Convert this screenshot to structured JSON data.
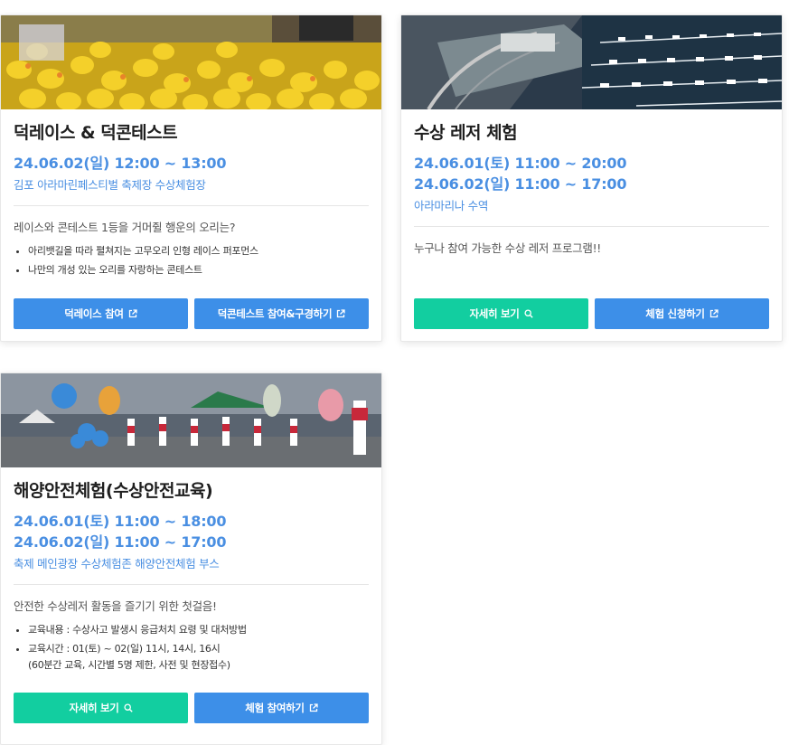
{
  "cards": [
    {
      "title": "덕레이스 & 덕콘테스트",
      "dates": [
        "24.06.02(일) 12:00 ~ 13:00"
      ],
      "location": "김포 아라마린페스티벌 축제장 수상체험장",
      "description": "레이스와 콘테스트 1등을 거머쥘 행운의 오리는?",
      "bullets": [
        "아리뱃길을 따라 펼쳐지는 고무오리 인형 레이스 퍼포먼스",
        "나만의 개성 있는 오리를 자랑하는 콘테스트"
      ],
      "buttons": [
        {
          "label": "덕레이스 참여",
          "icon": "external-link-icon",
          "color": "#3d8fe8"
        },
        {
          "label": "덕콘테스트 참여&구경하기",
          "icon": "external-link-icon",
          "color": "#3d8fe8"
        }
      ]
    },
    {
      "title": "수상 레저 체험",
      "dates": [
        "24.06.01(토) 11:00 ~ 20:00",
        "24.06.02(일) 11:00 ~ 17:00"
      ],
      "location": "아라마리나 수역",
      "description": "누구나 참여 가능한 수상 레저 프로그램!!",
      "buttons": [
        {
          "label": "자세히 보기",
          "icon": "search-icon",
          "color": "#12cea0"
        },
        {
          "label": "체험 신청하기",
          "icon": "external-link-icon",
          "color": "#3d8fe8"
        }
      ]
    },
    {
      "title": "해양안전체험(수상안전교육)",
      "dates": [
        "24.06.01(토) 11:00 ~ 18:00",
        "24.06.02(일) 11:00 ~ 17:00"
      ],
      "location": "축제 메인광장 수상체험존 해양안전체험 부스",
      "description": "안전한 수상레저 활동을 즐기기 위한 첫걸음!",
      "bullets": [
        "교육내용 : 수상사고 발생시 응급처치 요령 및 대처방법",
        "교육시간 : 01(토) ~ 02(일) 11시, 14시, 16시"
      ],
      "bullet_sub": "(60분간 교육, 시간별 5명 제한, 사전 및 현장접수)",
      "buttons": [
        {
          "label": "자세히 보기",
          "icon": "search-icon",
          "color": "#12cea0"
        },
        {
          "label": "체험 참여하기",
          "icon": "external-link-icon",
          "color": "#3d8fe8"
        }
      ]
    }
  ]
}
